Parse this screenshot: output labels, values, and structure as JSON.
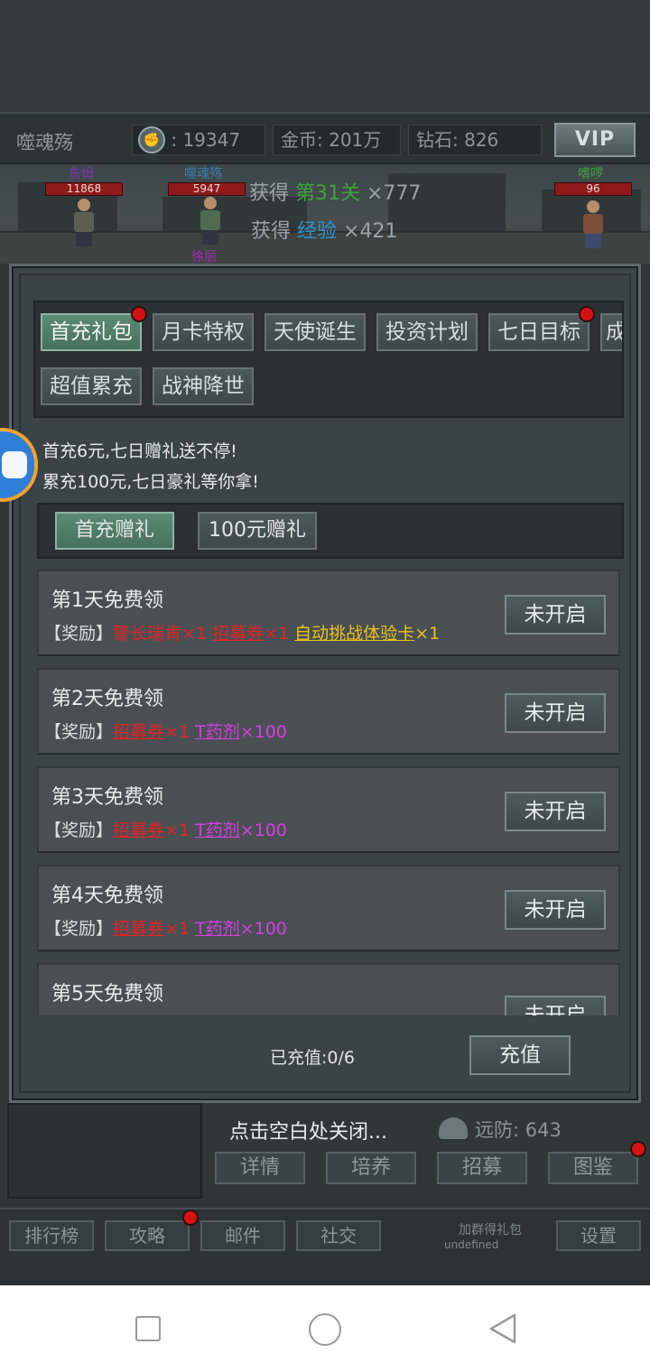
{
  "header": {
    "player_name": "噬魂殇",
    "power": ": 19347",
    "gold": "金币: 201万",
    "diamond": "钻石: 826",
    "vip_label": "VIP"
  },
  "battle": {
    "units": [
      {
        "name": "詹姆",
        "hp": "11868",
        "name_color": "#7a3aa8"
      },
      {
        "name": "噬魂殇",
        "hp": "5947",
        "name_color": "#3a7fb0"
      },
      {
        "name": "徐丽",
        "hp": "",
        "name_color": "#a02fb0"
      },
      {
        "name": "嗜啰",
        "hp": "96",
        "name_color": "#3fa03f"
      }
    ],
    "gain_lines": [
      {
        "prefix": "获得 ",
        "highlight": "第31关",
        "suffix": " ×777"
      },
      {
        "prefix": "获得 ",
        "highlight": "经验",
        "suffix": " ×421"
      }
    ]
  },
  "tabs": [
    {
      "label": "首充礼包",
      "active": true,
      "dot": true
    },
    {
      "label": "月卡特权",
      "active": false,
      "dot": false
    },
    {
      "label": "天使诞生",
      "active": false,
      "dot": false
    },
    {
      "label": "投资计划",
      "active": false,
      "dot": false
    },
    {
      "label": "七日目标",
      "active": false,
      "dot": true
    },
    {
      "label": "成",
      "active": false,
      "dot": false
    },
    {
      "label": "超值累充",
      "active": false,
      "dot": false
    },
    {
      "label": "战神降世",
      "active": false,
      "dot": false
    }
  ],
  "intro": {
    "line1": "首充6元,七日赠礼送不停!",
    "line2": "累充100元,七日豪礼等你拿!"
  },
  "sub_tabs": [
    {
      "label": "首充赠礼",
      "active": true
    },
    {
      "label": "100元赠礼",
      "active": false
    }
  ],
  "days": [
    {
      "title": "第1天免费领",
      "reward_prefix": "【奖励】",
      "rewards": [
        {
          "name": "警长瑞肯",
          "qty": "×1",
          "color": "red",
          "underline": false
        },
        {
          "name": "招募券",
          "qty": "×1",
          "color": "red",
          "underline": true
        },
        {
          "name": "自动挑战体验卡",
          "qty": "×1",
          "color": "yellow",
          "underline": true
        }
      ],
      "button": "未开启"
    },
    {
      "title": "第2天免费领",
      "reward_prefix": "【奖励】",
      "rewards": [
        {
          "name": "招募券",
          "qty": "×1",
          "color": "red",
          "underline": true
        },
        {
          "name": "T药剂",
          "qty": "×100",
          "color": "purple",
          "underline": true
        }
      ],
      "button": "未开启"
    },
    {
      "title": "第3天免费领",
      "reward_prefix": "【奖励】",
      "rewards": [
        {
          "name": "招募券",
          "qty": "×1",
          "color": "red",
          "underline": true
        },
        {
          "name": "T药剂",
          "qty": "×100",
          "color": "purple",
          "underline": true
        }
      ],
      "button": "未开启"
    },
    {
      "title": "第4天免费领",
      "reward_prefix": "【奖励】",
      "rewards": [
        {
          "name": "招募券",
          "qty": "×1",
          "color": "red",
          "underline": true
        },
        {
          "name": "T药剂",
          "qty": "×100",
          "color": "purple",
          "underline": true
        }
      ],
      "button": "未开启"
    },
    {
      "title": "第5天免费领",
      "reward_prefix": "",
      "rewards": [],
      "button": "未开启"
    }
  ],
  "footer": {
    "charged": "已充值:0/6",
    "charge_button": "充值"
  },
  "hud": {
    "close_hint": "点击空白处关闭...",
    "defense": "远防: 643",
    "buttons": [
      "详情",
      "培养",
      "招募",
      "图鉴"
    ]
  },
  "bottom_bar": {
    "buttons": [
      "排行榜",
      "攻略",
      "邮件",
      "社交"
    ],
    "group_gift": "加群得礼包",
    "undefined_text": "undefined",
    "settings": "设置"
  },
  "colors": {
    "active_tab": "#5b8a77",
    "red_dot": "#d51212",
    "reward_red": "#e02424",
    "reward_yellow": "#e8c21a",
    "reward_purple": "#d43ee0"
  },
  "icons": [
    "fist-icon",
    "gamepad-icon",
    "helmet-icon",
    "nav-recents-icon",
    "nav-home-icon",
    "nav-back-icon"
  ]
}
